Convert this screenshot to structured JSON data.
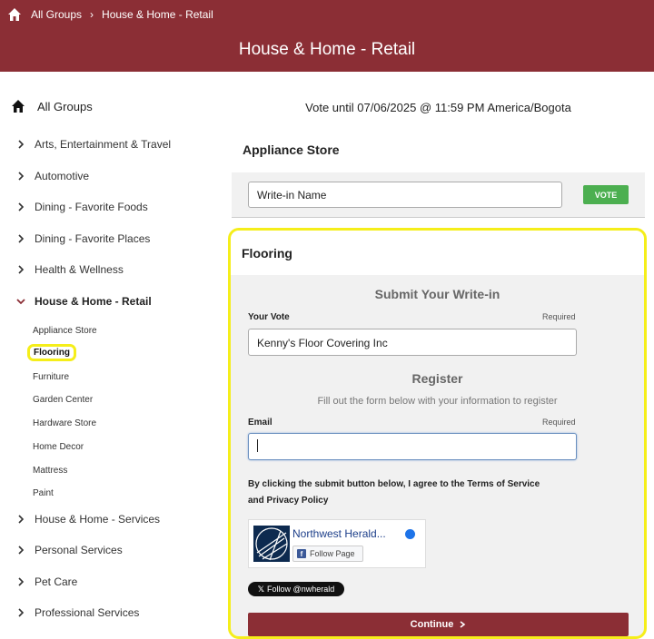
{
  "breadcrumb": {
    "home": "All Groups",
    "current": "House & Home - Retail"
  },
  "header": {
    "title": "House & Home - Retail"
  },
  "sidebar": {
    "all_groups": "All Groups",
    "groups": [
      "Arts, Entertainment & Travel",
      "Automotive",
      "Dining - Favorite Foods",
      "Dining - Favorite Places",
      "Health & Wellness",
      "House & Home - Retail",
      "House & Home - Services",
      "Personal Services",
      "Pet Care",
      "Professional Services"
    ],
    "sub_items": [
      "Appliance Store",
      "Flooring",
      "Furniture",
      "Garden Center",
      "Hardware Store",
      "Home Decor",
      "Mattress",
      "Paint"
    ],
    "active_sub": "Flooring"
  },
  "vote_until": "Vote until 07/06/2025 @ 11:59 PM America/Bogota",
  "appliance_card": {
    "title": "Appliance Store",
    "writein_value": "Write-in Name",
    "vote_label": "VOTE"
  },
  "flooring_card": {
    "title": "Flooring",
    "subtitle": "Submit Your Write-in",
    "your_vote_label": "Your Vote",
    "required": "Required",
    "your_vote_value": "Kenny's Floor Covering Inc",
    "register_title": "Register",
    "register_sub": "Fill out the form below with your information to register",
    "email_label": "Email",
    "email_value": "",
    "terms": "By clicking the submit button below, I agree to the Terms of Service and Privacy Policy",
    "fb_page_name": "Northwest Herald...",
    "fb_follow": "Follow Page",
    "twitter_follow": "Follow @nwherald",
    "continue_label": "Continue"
  },
  "colors": {
    "brand": "#8b2e35",
    "vote_green": "#4caf50",
    "highlight": "#f5ee1a"
  }
}
